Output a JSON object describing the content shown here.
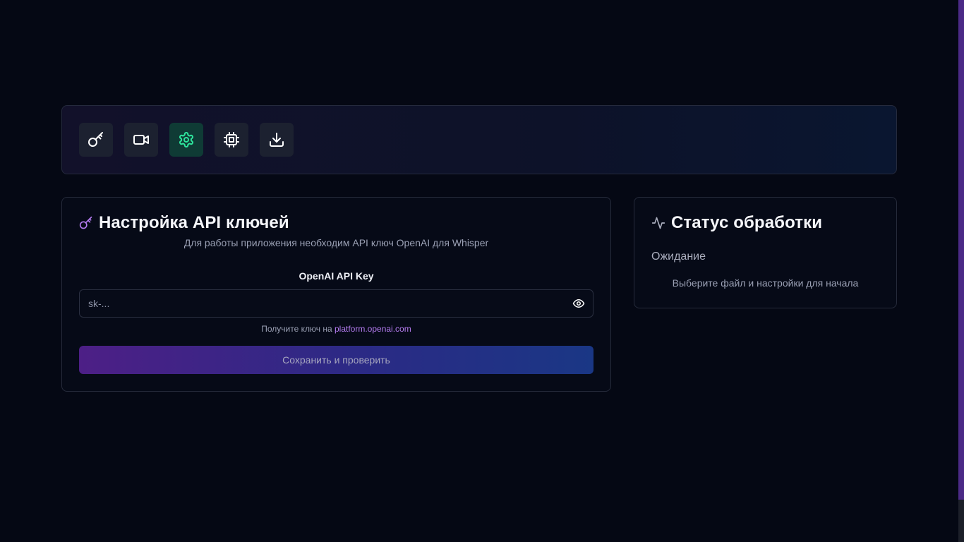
{
  "toolbar": {
    "buttons": [
      {
        "icon": "key-icon",
        "active": false
      },
      {
        "icon": "video-icon",
        "active": false
      },
      {
        "icon": "gear-icon",
        "active": true
      },
      {
        "icon": "cpu-icon",
        "active": false
      },
      {
        "icon": "download-icon",
        "active": false
      }
    ],
    "accent_active": "#2ee59d"
  },
  "api_card": {
    "title": "Настройка API ключей",
    "subtitle": "Для работы приложения необходим API ключ OpenAI для Whisper",
    "field_label": "OpenAI API Key",
    "field_value": "",
    "field_placeholder": "sk-...",
    "hint_prefix": "Получите ключ на ",
    "hint_link": "platform.openai.com",
    "save_label": "Сохранить и проверить",
    "title_icon_color": "#b47cf0"
  },
  "status_card": {
    "title": "Статус обработки",
    "state": "Ожидание",
    "description": "Выберите файл и настройки для начала"
  }
}
